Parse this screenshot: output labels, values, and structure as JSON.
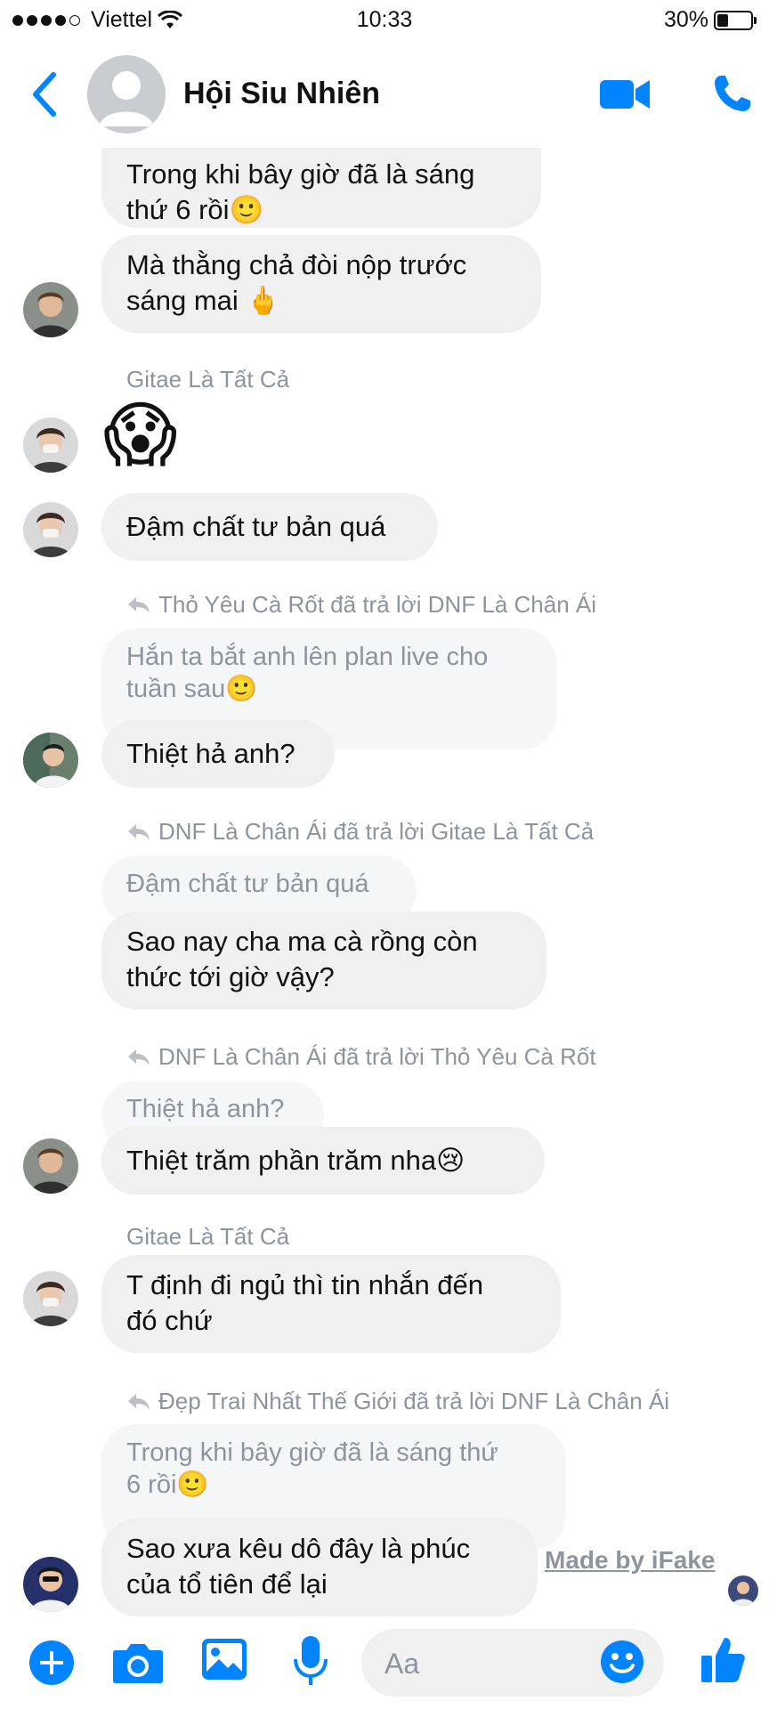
{
  "status_bar": {
    "carrier": "Viettel",
    "time": "10:33",
    "battery": "30%"
  },
  "header": {
    "title": "Hội Siu Nhiên"
  },
  "messages": [
    {
      "text": "Trong khi bây giờ đã là sáng\nthứ 6 rồi🙂"
    },
    {
      "text": "Mà thằng chả đòi nộp trước\nsáng mai 🖕"
    },
    {
      "sender": "Gitae Là Tất Cả",
      "emoji": "😱"
    },
    {
      "text": "Đậm chất tư bản quá"
    },
    {
      "reply_meta": "Thỏ Yêu Cà Rốt đã trả lời DNF Là Chân Ái",
      "quoted": "Hắn ta bắt anh lên plan live cho\ntuần sau🙂",
      "text": "Thiệt hả anh?"
    },
    {
      "reply_meta": "DNF Là Chân Ái đã trả lời Gitae Là Tất Cả",
      "quoted": "Đậm chất tư bản quá",
      "text": "Sao nay cha ma cà rồng còn\nthức tới giờ vậy?"
    },
    {
      "reply_meta": "DNF Là Chân Ái đã trả lời Thỏ Yêu Cà Rốt",
      "quoted": "Thiệt hả anh?",
      "text": "Thiệt trăm phần trăm nha😢"
    },
    {
      "sender": "Gitae Là Tất Cả",
      "text": "T định đi ngủ thì tin nhắn đến\nđó chứ"
    },
    {
      "reply_meta": "Đẹp Trai Nhất Thế Giới đã trả lời DNF Là Chân Ái",
      "quoted": "Trong khi bây giờ đã là sáng thứ\n6 rồi🙂",
      "text": "Sao xưa kêu dô đây là phúc\ncủa tổ tiên để lại"
    }
  ],
  "watermark": "Made by iFake",
  "composer": {
    "placeholder": "Aa"
  },
  "colors": {
    "accent": "#0084ff",
    "bubble": "#f1f0f0",
    "meta": "#8d949e"
  }
}
